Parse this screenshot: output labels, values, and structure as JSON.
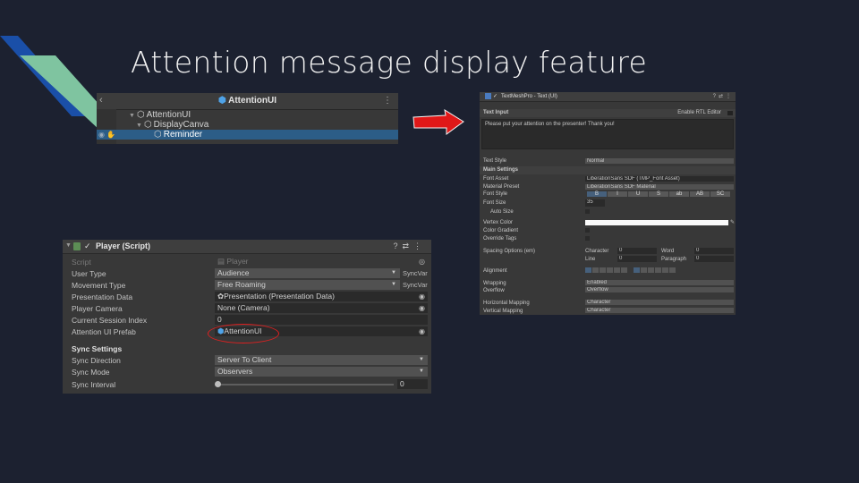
{
  "slide": {
    "title": "Attention message display feature"
  },
  "hierarchy": {
    "header_title": "AttentionUI",
    "items": [
      {
        "label": "AttentionUI",
        "level": 1,
        "selected": false
      },
      {
        "label": "DisplayCanva",
        "level": 2,
        "selected": false
      },
      {
        "label": "Reminder",
        "level": 3,
        "selected": true
      }
    ]
  },
  "tmp": {
    "header_title": "TextMeshPro - Text (UI)",
    "text_input_label": "Text Input",
    "enable_rtl_label": "Enable RTL Editor",
    "text": "Please put your attention on the presenter! Thank you!",
    "text_style_label": "Text Style",
    "text_style_value": "Normal",
    "main_settings_label": "Main Settings",
    "font_asset_label": "Font Asset",
    "font_asset_value": "LiberationSans SDF (TMP_Font Asset)",
    "material_preset_label": "Material Preset",
    "material_preset_value": "LiberationSans SDF Material",
    "font_style_label": "Font Style",
    "font_style_buttons": [
      "B",
      "I",
      "U",
      "S",
      "ab",
      "AB",
      "SC"
    ],
    "font_size_label": "Font Size",
    "font_size_value": "35",
    "auto_size_label": "Auto Size",
    "vertex_color_label": "Vertex Color",
    "color_gradient_label": "Color Gradient",
    "override_tags_label": "Override Tags",
    "spacing_label": "Spacing Options (em)",
    "character_label": "Character",
    "character_value": "0",
    "word_label": "Word",
    "word_value": "0",
    "line_label": "Line",
    "line_value": "0",
    "paragraph_label": "Paragraph",
    "paragraph_value": "0",
    "alignment_label": "Alignment",
    "wrapping_label": "Wrapping",
    "wrapping_value": "Enabled",
    "overflow_label": "Overflow",
    "overflow_value": "Overflow",
    "hmapping_label": "Horizontal Mapping",
    "hmapping_value": "Character",
    "vmapping_label": "Vertical Mapping",
    "vmapping_value": "Character"
  },
  "player": {
    "header_title": "Player (Script)",
    "script_label": "Script",
    "script_value": "Player",
    "user_type_label": "User Type",
    "user_type_value": "Audience",
    "movement_type_label": "Movement Type",
    "movement_type_value": "Free Roaming",
    "syncvar_label": "SyncVar",
    "presentation_data_label": "Presentation Data",
    "presentation_data_value": "Presentation (Presentation Data)",
    "player_camera_label": "Player Camera",
    "player_camera_value": "None (Camera)",
    "session_index_label": "Current Session Index",
    "session_index_value": "0",
    "attention_prefab_label": "Attention UI Prefab",
    "attention_prefab_value": "AttentionUI",
    "sync_settings_label": "Sync Settings",
    "sync_direction_label": "Sync Direction",
    "sync_direction_value": "Server To Client",
    "sync_mode_label": "Sync Mode",
    "sync_mode_value": "Observers",
    "sync_interval_label": "Sync Interval",
    "sync_interval_value": "0"
  },
  "colors": {
    "background": "#1c2130",
    "accent_blue": "#1a4fa8",
    "accent_green": "#7fc4a0",
    "arrow_red": "#e01818",
    "selection": "#2c5d87"
  }
}
